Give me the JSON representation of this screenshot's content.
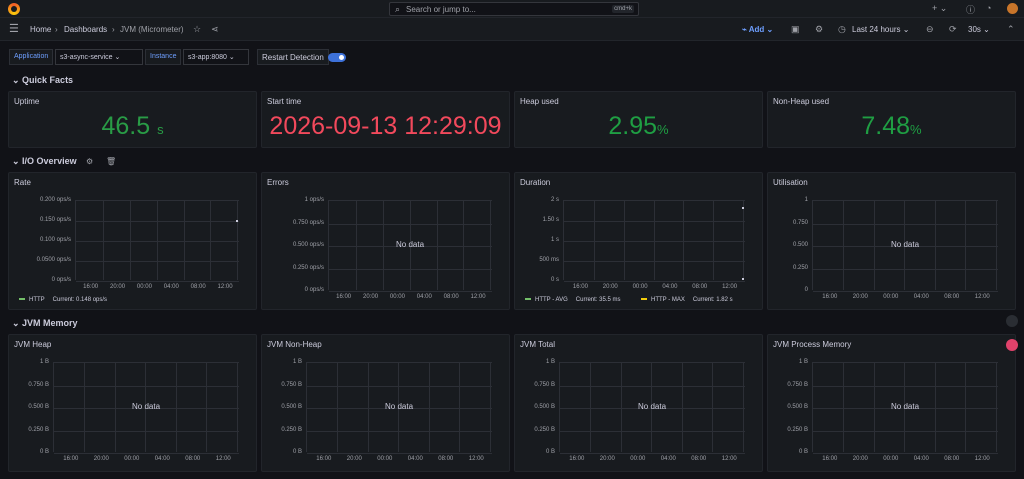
{
  "search": {
    "placeholder": "Search or jump to...",
    "shortcut": "cmd+k"
  },
  "breadcrumb": {
    "home": "Home",
    "dashboards": "Dashboards",
    "current": "JVM (Micrometer)"
  },
  "toolbar": {
    "add": "Add",
    "time_range": "Last 24 hours",
    "refresh": "30s"
  },
  "variables": {
    "application_label": "Application",
    "application_value": "s3-async-service",
    "instance_label": "Instance",
    "instance_value": "s3-app:8080",
    "restart_label": "Restart Detection"
  },
  "rows": {
    "quick_facts": "Quick Facts",
    "io_overview": "I/O Overview",
    "jvm_memory": "JVM Memory"
  },
  "stats": [
    {
      "title": "Uptime",
      "value": "46.5",
      "unit": "s",
      "color": "#299c46"
    },
    {
      "title": "Start time",
      "value": "2026-09-13 12:29:09",
      "unit": "",
      "color": "#f2495c"
    },
    {
      "title": "Heap used",
      "value": "2.95",
      "unit": "%",
      "color": "#299c46"
    },
    {
      "title": "Non-Heap used",
      "value": "7.48",
      "unit": "%",
      "color": "#299c46"
    }
  ],
  "x_ticks": [
    "16:00",
    "20:00",
    "00:00",
    "04:00",
    "08:00",
    "12:00"
  ],
  "no_data": "No data",
  "io_panels": [
    {
      "title": "Rate",
      "y_ticks": [
        "0.200 ops/s",
        "0.150 ops/s",
        "0.100 ops/s",
        "0.0500 ops/s",
        "0 ops/s"
      ]
    },
    {
      "title": "Errors",
      "y_ticks": [
        "1 ops/s",
        "0.750 ops/s",
        "0.500 ops/s",
        "0.250 ops/s",
        "0 ops/s"
      ]
    },
    {
      "title": "Duration",
      "y_ticks": [
        "2 s",
        "1.50 s",
        "1 s",
        "500 ms",
        "0 s"
      ]
    },
    {
      "title": "Utilisation",
      "y_ticks": [
        "1",
        "0.750",
        "0.500",
        "0.250",
        "0"
      ]
    }
  ],
  "legends": {
    "rate": {
      "name": "HTTP",
      "current": "Current: 0.148 ops/s",
      "color": "#73bf69"
    },
    "duration_avg": {
      "name": "HTTP - AVG",
      "current": "Current: 35.5 ms",
      "color": "#73bf69"
    },
    "duration_max": {
      "name": "HTTP - MAX",
      "current": "Current: 1.82 s",
      "color": "#f2cc0c"
    }
  },
  "mem_panels": [
    {
      "title": "JVM Heap",
      "y_ticks": [
        "1 B",
        "0.750 B",
        "0.500 B",
        "0.250 B",
        "0 B"
      ]
    },
    {
      "title": "JVM Non-Heap",
      "y_ticks": [
        "1 B",
        "0.750 B",
        "0.500 B",
        "0.250 B",
        "0 B"
      ]
    },
    {
      "title": "JVM Total",
      "y_ticks": [
        "1 B",
        "0.750 B",
        "0.500 B",
        "0.250 B",
        "0 B"
      ]
    },
    {
      "title": "JVM Process Memory",
      "y_ticks": [
        "1 B",
        "0.750 B",
        "0.500 B",
        "0.250 B",
        "0 B"
      ]
    }
  ]
}
